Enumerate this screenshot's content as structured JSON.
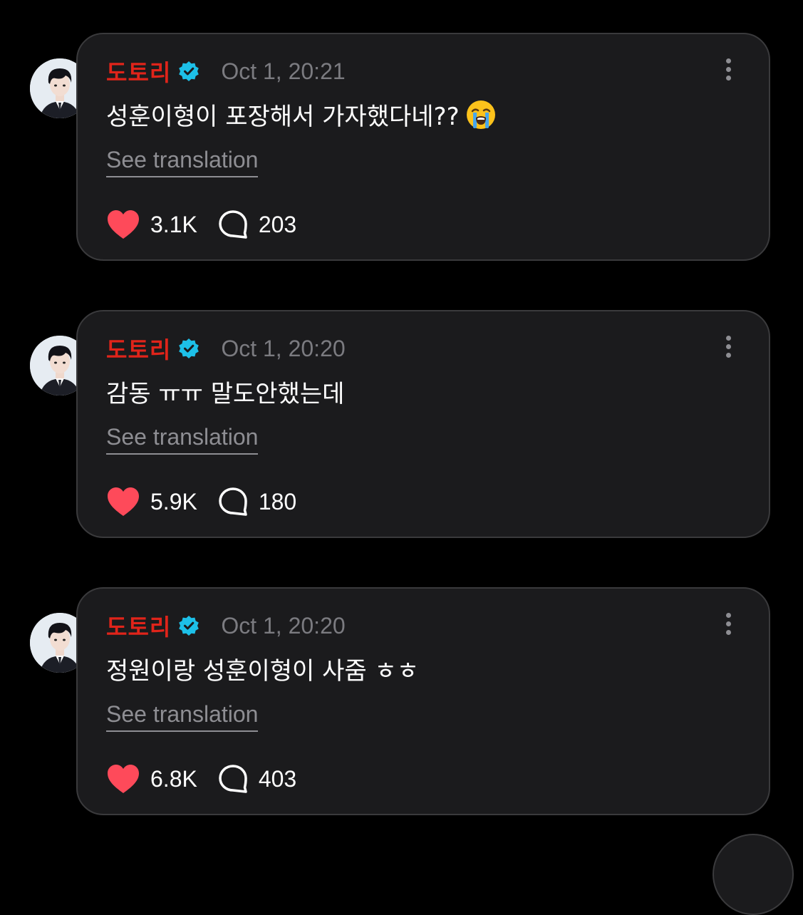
{
  "posts": [
    {
      "username": "도토리",
      "verified": true,
      "timestamp": "Oct 1, 20:21",
      "text": "성훈이형이 포장해서 가자했다네??",
      "emoji": "loudly-crying-face",
      "translate_label": "See translation",
      "likes": "3.1K",
      "comments": "203"
    },
    {
      "username": "도토리",
      "verified": true,
      "timestamp": "Oct 1, 20:20",
      "text": "감동 ㅠㅠ 말도안했는데",
      "emoji": "",
      "translate_label": "See translation",
      "likes": "5.9K",
      "comments": "180"
    },
    {
      "username": "도토리",
      "verified": true,
      "timestamp": "Oct 1, 20:20",
      "text": "정원이랑 성훈이형이 사줌 ㅎㅎ",
      "emoji": "",
      "translate_label": "See translation",
      "likes": "6.8K",
      "comments": "403"
    }
  ],
  "colors": {
    "background": "#000000",
    "card": "#1b1b1d",
    "card_border": "#3a3a3c",
    "username": "#e0241a",
    "verified_badge": "#1dc0e8",
    "heart": "#fe4a5a",
    "muted": "#8e8e93"
  },
  "icons": [
    "verified-badge-icon",
    "more-options-icon",
    "heart-icon",
    "comment-icon"
  ]
}
